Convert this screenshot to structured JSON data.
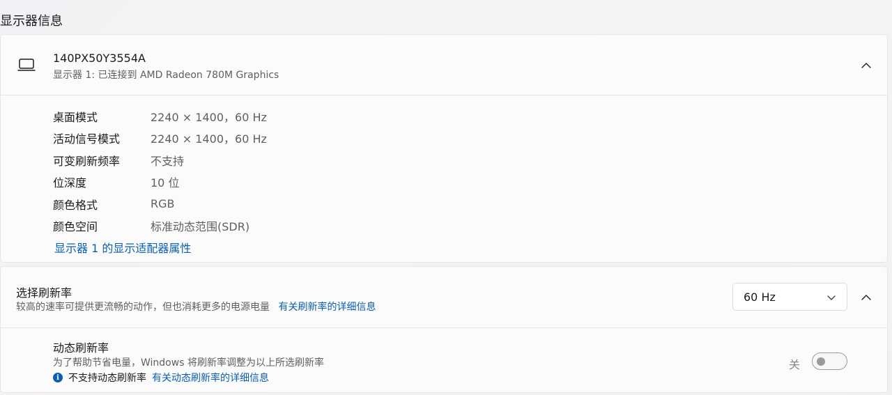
{
  "section_title": "显示器信息",
  "display": {
    "name": "140PX50Y3554A",
    "subtitle": "显示器 1: 已连接到 AMD Radeon 780M Graphics",
    "icon": "laptop-icon",
    "rows": [
      {
        "label": "桌面模式",
        "value": "2240 × 1400，60 Hz"
      },
      {
        "label": "活动信号模式",
        "value": "2240 × 1400，60 Hz"
      },
      {
        "label": "可变刷新频率",
        "value": "不支持"
      },
      {
        "label": "位深度",
        "value": "10 位"
      },
      {
        "label": "颜色格式",
        "value": "RGB"
      },
      {
        "label": "颜色空间",
        "value": "标准动态范围(SDR)"
      }
    ],
    "adapter_link": "显示器 1 的显示适配器属性"
  },
  "refresh": {
    "title": "选择刷新率",
    "subtitle": "较高的速率可提供更流畅的动作，但也消耗更多的电源电量",
    "details_link": "有关刷新率的详细信息",
    "selected_rate": "60 Hz"
  },
  "dynamic": {
    "title": "动态刷新率",
    "subtitle": "为了帮助节省电量，Windows 将刷新率调整为以上所选刷新率",
    "not_supported": "不支持动态刷新率",
    "details_link": "有关动态刷新率的详细信息",
    "toggle_state_label": "关",
    "toggle_on": false
  },
  "colors": {
    "accent": "#0a5fb4",
    "secondary_text": "#5f5f5f"
  }
}
